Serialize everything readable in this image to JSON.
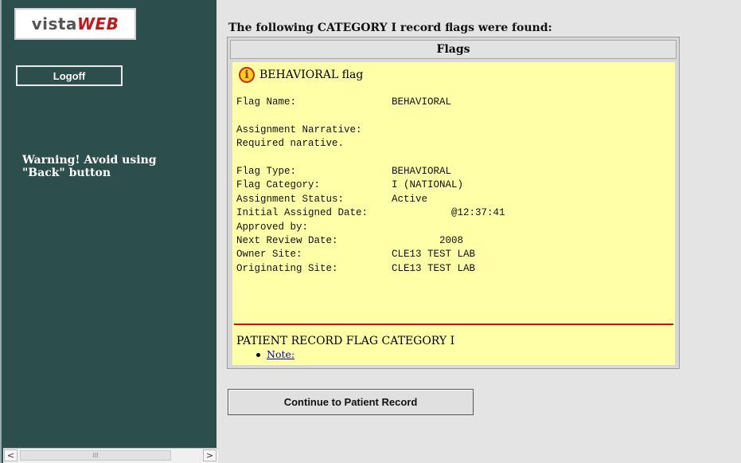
{
  "sidebar": {
    "logo_part1": "vista",
    "logo_part2": "WEB",
    "logoff_label": "Logoff",
    "warning_line1": "Warning! Avoid using",
    "warning_line2": "\"Back\" button",
    "scroll_left": "<",
    "scroll_right": ">",
    "scroll_grip": "III"
  },
  "main": {
    "heading": "The following CATEGORY I record flags were found:",
    "panel_title": "Flags",
    "flag_title": "BEHAVIORAL flag",
    "info_icon_glyph": "i",
    "flag_details": "Flag Name:                BEHAVIORAL\n\nAssignment Narrative:\nRequired narative.\n\nFlag Type:                BEHAVIORAL\nFlag Category:            I (NATIONAL)\nAssignment Status:        Active\nInitial Assigned Date:              @12:37:41\nApproved by:\nNext Review Date:                 2008\nOwner Site:               CLE13 TEST LAB\nOriginating Site:         CLE13 TEST LAB",
    "category_title": "PATIENT RECORD FLAG CATEGORY I",
    "note_link": "Note:",
    "continue_label": "Continue to Patient Record"
  },
  "colors": {
    "sidebar_bg": "#2c4e4c",
    "flag_bg": "#ffffa8",
    "divider": "#c81010",
    "link": "#0000cc"
  },
  "icons": [
    "info-icon",
    "chevron-left-icon",
    "chevron-right-icon"
  ]
}
